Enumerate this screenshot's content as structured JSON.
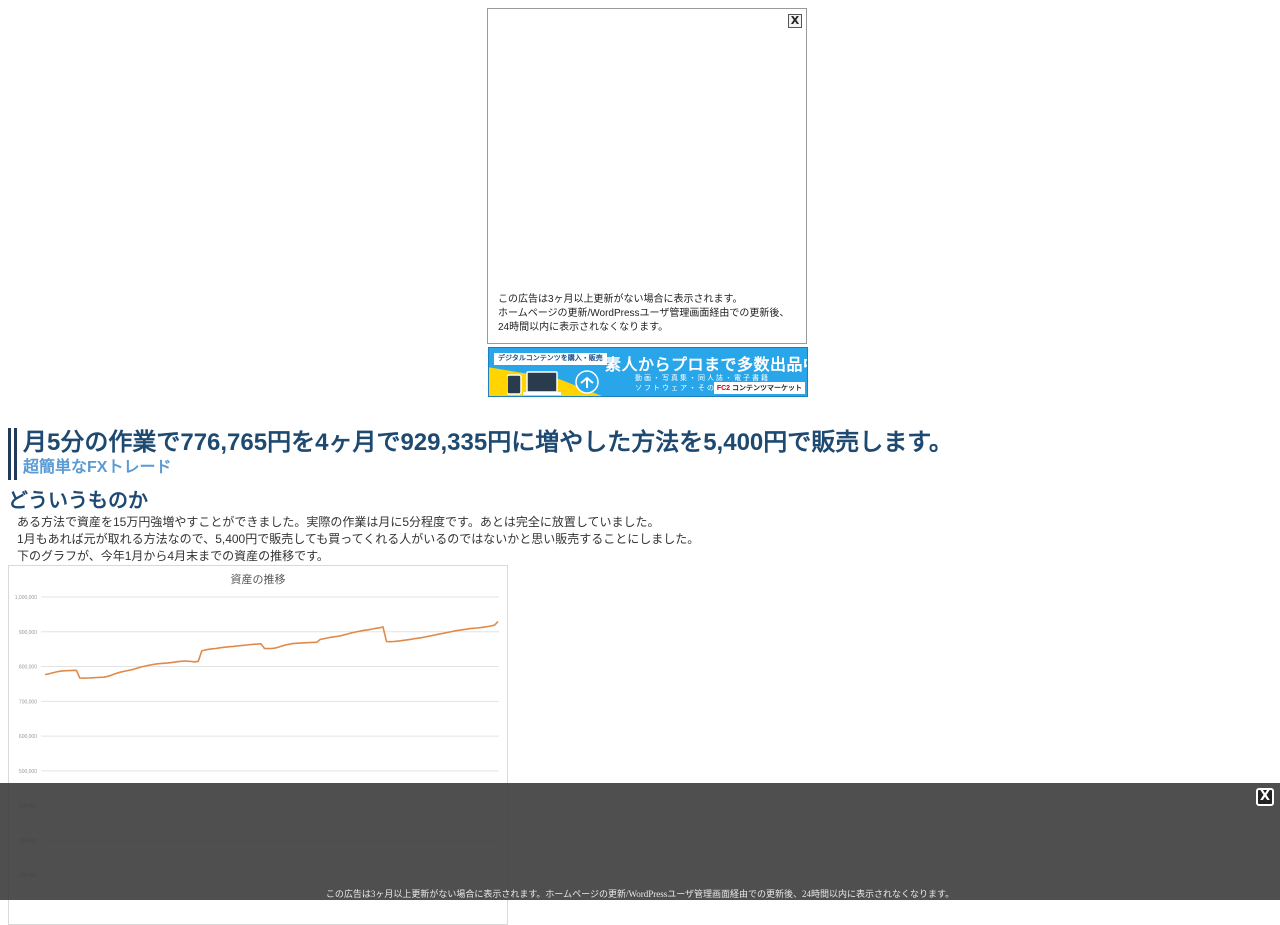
{
  "top_ad": {
    "close_label": "X",
    "notice_lines": [
      "この広告は3ヶ月以上更新がない場合に表示されます。",
      "ホームページの更新/WordPressユーザ管理画面経由での更新後、",
      "24時間以内に表示されなくなります。"
    ]
  },
  "banner": {
    "tag": "デジタルコンテンツを購入・販売",
    "headline": "素人からプロまで多数出品中!",
    "sub_line1": "動画・写真集・同人誌・電子書籍",
    "sub_line2": "ソフトウェア・その他",
    "logo_mark": "FC2",
    "logo_text": "コンテンツマーケット",
    "colors": {
      "background": "#29a6ea",
      "accent": "#ffd400"
    }
  },
  "article": {
    "title": "月5分の作業で776,765円を4ヶ月で929,335円に増やした方法を5,400円で販売します。",
    "subtitle": "超簡単なFXトレード",
    "section_heading": "どういうものか",
    "paragraphs": [
      "ある方法で資産を15万円強増やすことができました。実際の作業は月に5分程度です。あとは完全に放置していました。",
      "1月もあれば元が取れる方法なので、5,400円で販売しても買ってくれる人がいるのではないかと思い販売することにしました。",
      "下のグラフが、今年1月から4月末までの資産の推移です。"
    ]
  },
  "chart_data": {
    "type": "line",
    "title": "資産の推移",
    "xlabel": "",
    "ylabel": "",
    "ylim": [
      100000,
      1000000
    ],
    "yticks": [
      "1,000,000",
      "900,000",
      "800,000",
      "700,000",
      "600,000",
      "500,000",
      "400,000",
      "300,000",
      "200,000"
    ],
    "grid": true,
    "series": [
      {
        "color": "#e08a4a",
        "values": [
          776765,
          779000,
          781500,
          784000,
          786000,
          787500,
          788000,
          788500,
          789000,
          789200,
          767000,
          766500,
          767000,
          767500,
          768000,
          768500,
          769000,
          769500,
          772000,
          775000,
          779000,
          782000,
          785000,
          787000,
          789000,
          791000,
          794000,
          797000,
          800000,
          802000,
          804000,
          806000,
          807500,
          808500,
          809500,
          810000,
          811000,
          812500,
          814000,
          815000,
          816000,
          815500,
          814500,
          813500,
          815000,
          845000,
          848000,
          849500,
          851000,
          852000,
          853500,
          855000,
          856000,
          857000,
          858000,
          859000,
          860000,
          861000,
          862000,
          863000,
          864000,
          864500,
          865500,
          852000,
          851500,
          852000,
          853000,
          856000,
          859000,
          862000,
          864000,
          866000,
          867000,
          867500,
          868000,
          868500,
          869000,
          869500,
          870000,
          878000,
          880000,
          882000,
          884000,
          885500,
          887000,
          889000,
          891500,
          894000,
          897000,
          899000,
          901000,
          903000,
          904500,
          906000,
          908000,
          910000,
          911500,
          914000,
          872000,
          871500,
          872000,
          873000,
          874000,
          875500,
          877000,
          878500,
          880000,
          881500,
          883000,
          885000,
          887000,
          889000,
          891000,
          893000,
          895000,
          897000,
          899000,
          901000,
          903000,
          904500,
          906000,
          907500,
          909000,
          910000,
          911000,
          912000,
          913500,
          915000,
          917000,
          919000,
          929335
        ]
      }
    ]
  },
  "bottom_ad": {
    "close_label": "X",
    "notice": "この広告は3ヶ月以上更新がない場合に表示されます。ホームページの更新/WordPressユーザ管理画面経由での更新後、24時間以内に表示されなくなります。"
  }
}
